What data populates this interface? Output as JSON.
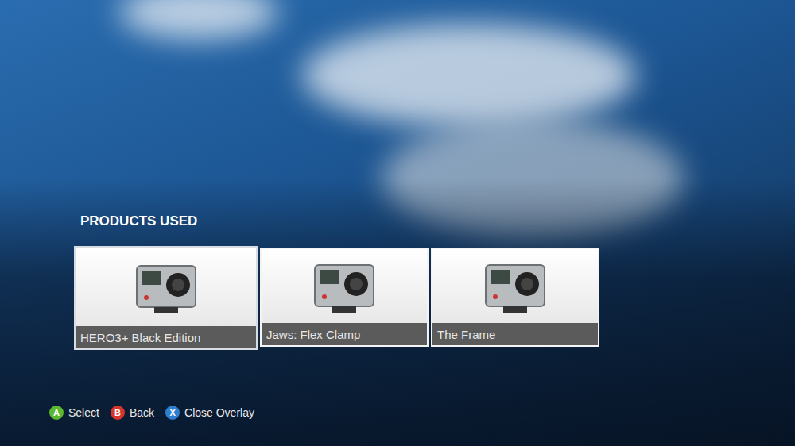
{
  "section": {
    "title": "PRODUCTS USED"
  },
  "products": [
    {
      "name": "HERO3+ Black Edition",
      "selected": true
    },
    {
      "name": "Jaws: Flex Clamp",
      "selected": false
    },
    {
      "name": "The Frame",
      "selected": false
    }
  ],
  "controls": [
    {
      "key": "A",
      "label": "Select",
      "color": "#5cb82e"
    },
    {
      "key": "B",
      "label": "Back",
      "color": "#d9342b"
    },
    {
      "key": "X",
      "label": "Close Overlay",
      "color": "#2f7fd1"
    }
  ]
}
